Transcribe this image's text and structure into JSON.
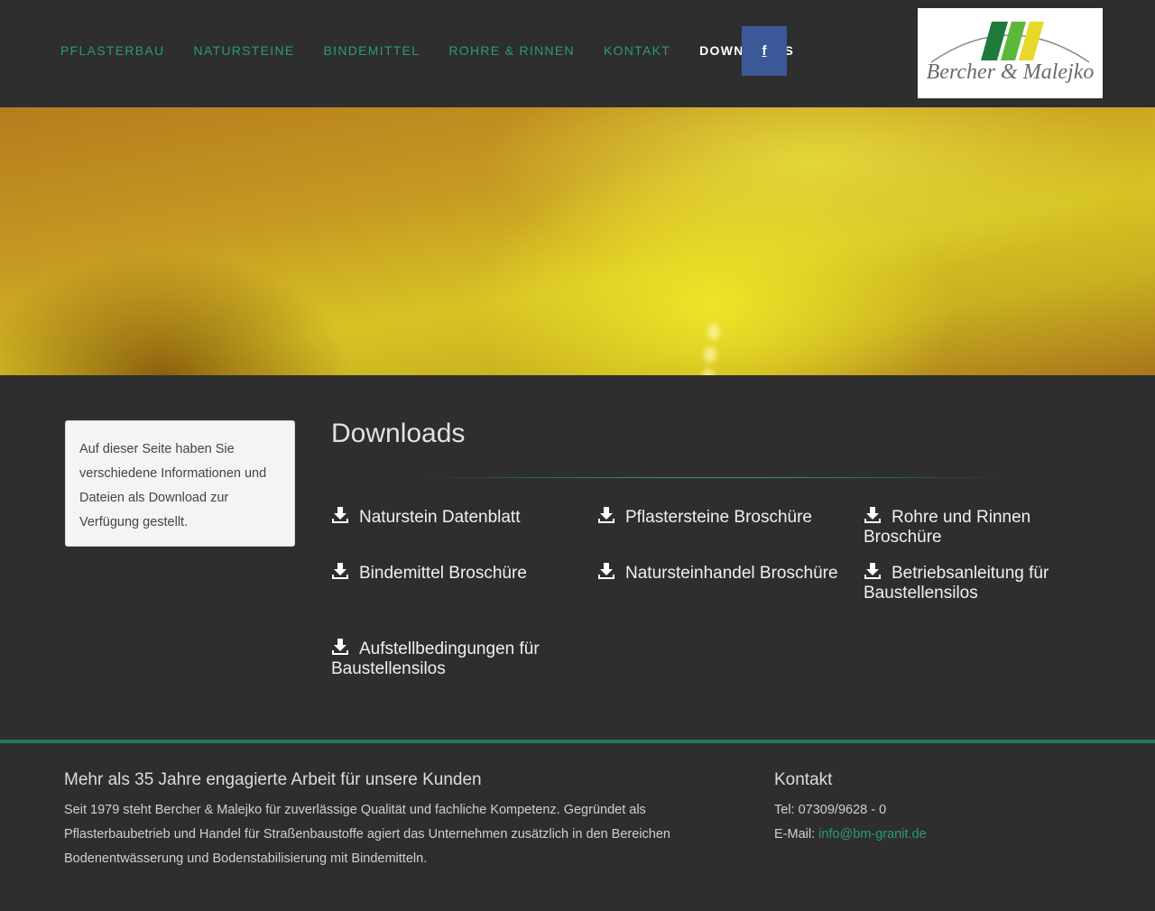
{
  "nav": {
    "items": [
      {
        "label": "PFLASTERBAU"
      },
      {
        "label": "NATURSTEINE"
      },
      {
        "label": "BINDEMITTEL"
      },
      {
        "label": "ROHRE & RINNEN"
      },
      {
        "label": "KONTAKT"
      },
      {
        "label": "DOWNLOADS"
      }
    ],
    "social_label": "f"
  },
  "logo": {
    "text": "Bercher & Malejko"
  },
  "sidebar": {
    "text": "Auf dieser Seite haben Sie verschiedene Informationen und Dateien als Download zur Verfügung gestellt."
  },
  "main": {
    "title": "Downloads",
    "downloads": [
      {
        "label": "Naturstein Datenblatt"
      },
      {
        "label": "Pflastersteine Broschüre"
      },
      {
        "label": "Rohre und Rinnen Broschüre"
      },
      {
        "label": "Bindemittel Broschüre"
      },
      {
        "label": "Natursteinhandel Broschüre"
      },
      {
        "label": "Betriebsanleitung für Baustellensilos"
      },
      {
        "label": "Aufstellbedingungen für Baustellensilos"
      }
    ]
  },
  "footer": {
    "about_heading": "Mehr als 35 Jahre engagierte Arbeit für unsere Kunden",
    "about_text": "Seit 1979 steht Bercher & Malejko für zuverlässige Qualität und fachliche Kompetenz. Gegründet als Pflasterbaubetrieb und Handel für Straßenbaustoffe agiert das Unternehmen zusätzlich in den Bereichen Bodenentwässerung und Bodenstabilisierung mit Bindemitteln.",
    "contact_heading": "Kontakt",
    "tel": "Tel: 07309/9628 - 0",
    "email_label": "E-Mail:",
    "email": "info@bm-granit.de"
  },
  "colors": {
    "accent": "#2a9d6a",
    "facebook": "#3b5998",
    "background": "#2e2e2e"
  },
  "icons": {
    "download": "download-icon",
    "facebook": "facebook-icon"
  }
}
